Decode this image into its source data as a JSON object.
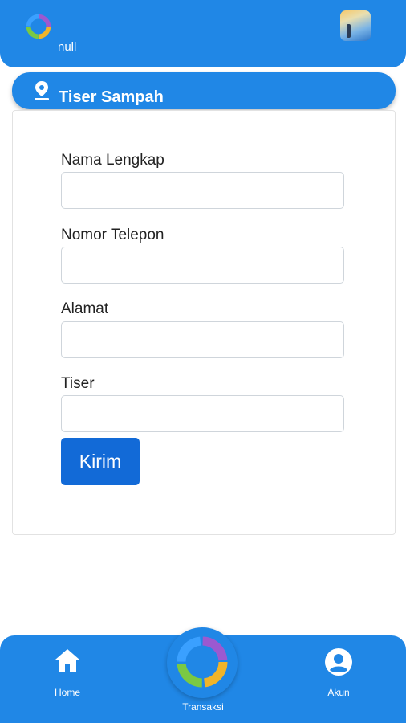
{
  "topbar": {
    "username": "null",
    "logo_icon": "app-logo-icon",
    "avatar_icon": "profile-avatar"
  },
  "header": {
    "title": "Tiser Sampah",
    "icon": "location-pin-icon"
  },
  "form": {
    "fields": [
      {
        "label": "Nama Lengkap",
        "value": "",
        "placeholder": ""
      },
      {
        "label": "Nomor Telepon",
        "value": "",
        "placeholder": ""
      },
      {
        "label": "Alamat",
        "value": "",
        "placeholder": ""
      },
      {
        "label": "Tiser",
        "value": "",
        "placeholder": ""
      }
    ],
    "submit_label": "Kirim"
  },
  "bottom_nav": {
    "home": {
      "label": "Home",
      "icon": "home-icon"
    },
    "transaksi": {
      "label": "Transaksi",
      "icon": "app-logo-icon"
    },
    "akun": {
      "label": "Akun",
      "icon": "account-circle-icon"
    }
  },
  "colors": {
    "primary": "#2087e6",
    "button": "#126ad7",
    "background": "#ffffff"
  }
}
